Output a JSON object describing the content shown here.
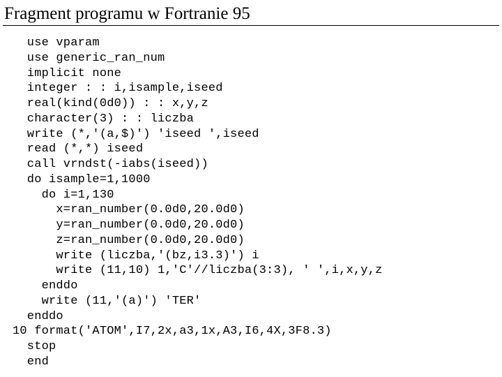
{
  "heading": "Fragment programu w Fortranie 95",
  "code": {
    "lines": [
      "  use vparam",
      "  use generic_ran_num",
      "  implicit none",
      "  integer : : i,isample,iseed",
      "  real(kind(0d0)) : : x,y,z",
      "  character(3) : : liczba",
      "  write (*,'(a,$)') 'iseed ',iseed",
      "  read (*,*) iseed",
      "  call vrndst(-iabs(iseed))",
      "  do isample=1,1000",
      "    do i=1,130",
      "      x=ran_number(0.0d0,20.0d0)",
      "      y=ran_number(0.0d0,20.0d0)",
      "      z=ran_number(0.0d0,20.0d0)",
      "      write (liczba,'(bz,i3.3)') i",
      "      write (11,10) 1,'C'//liczba(3:3), ' ',i,x,y,z",
      "    enddo",
      "    write (11,'(a)') 'TER'",
      "  enddo",
      "10 format('ATOM',I7,2x,a3,1x,A3,I6,4X,3F8.3)",
      "  stop",
      "  end"
    ]
  }
}
